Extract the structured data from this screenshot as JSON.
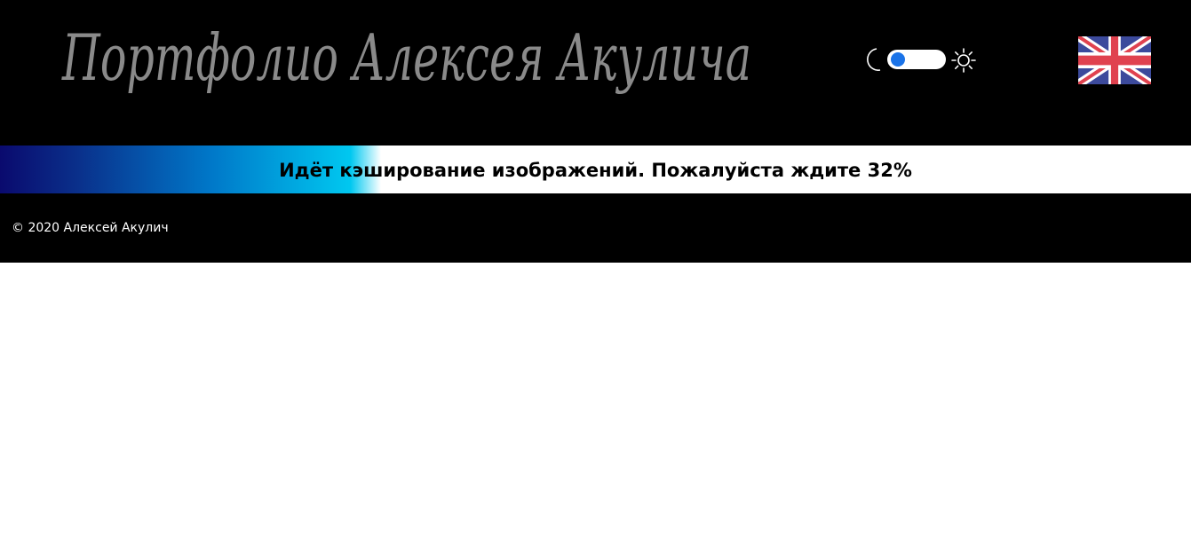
{
  "header": {
    "logo_text": "Портфолио Алексея Акулича",
    "logo_color": "#8a8a8a",
    "background": "#000000"
  },
  "theme_toggle": {
    "left_icon": "moon-icon",
    "right_icon": "sun-icon",
    "knob_color": "#1a73e8"
  },
  "language": {
    "flag_icon": "uk-flag-icon"
  },
  "progress": {
    "text": "Идёт кэширование изображений. Пожалуйста ждите 32%",
    "fraction": 0.32,
    "gradient_colors": [
      "#0a0a6e",
      "#0077c8",
      "#00c8f0"
    ]
  },
  "footer": {
    "copyright": "© 2020 Алексей Акулич",
    "background": "#000000"
  }
}
